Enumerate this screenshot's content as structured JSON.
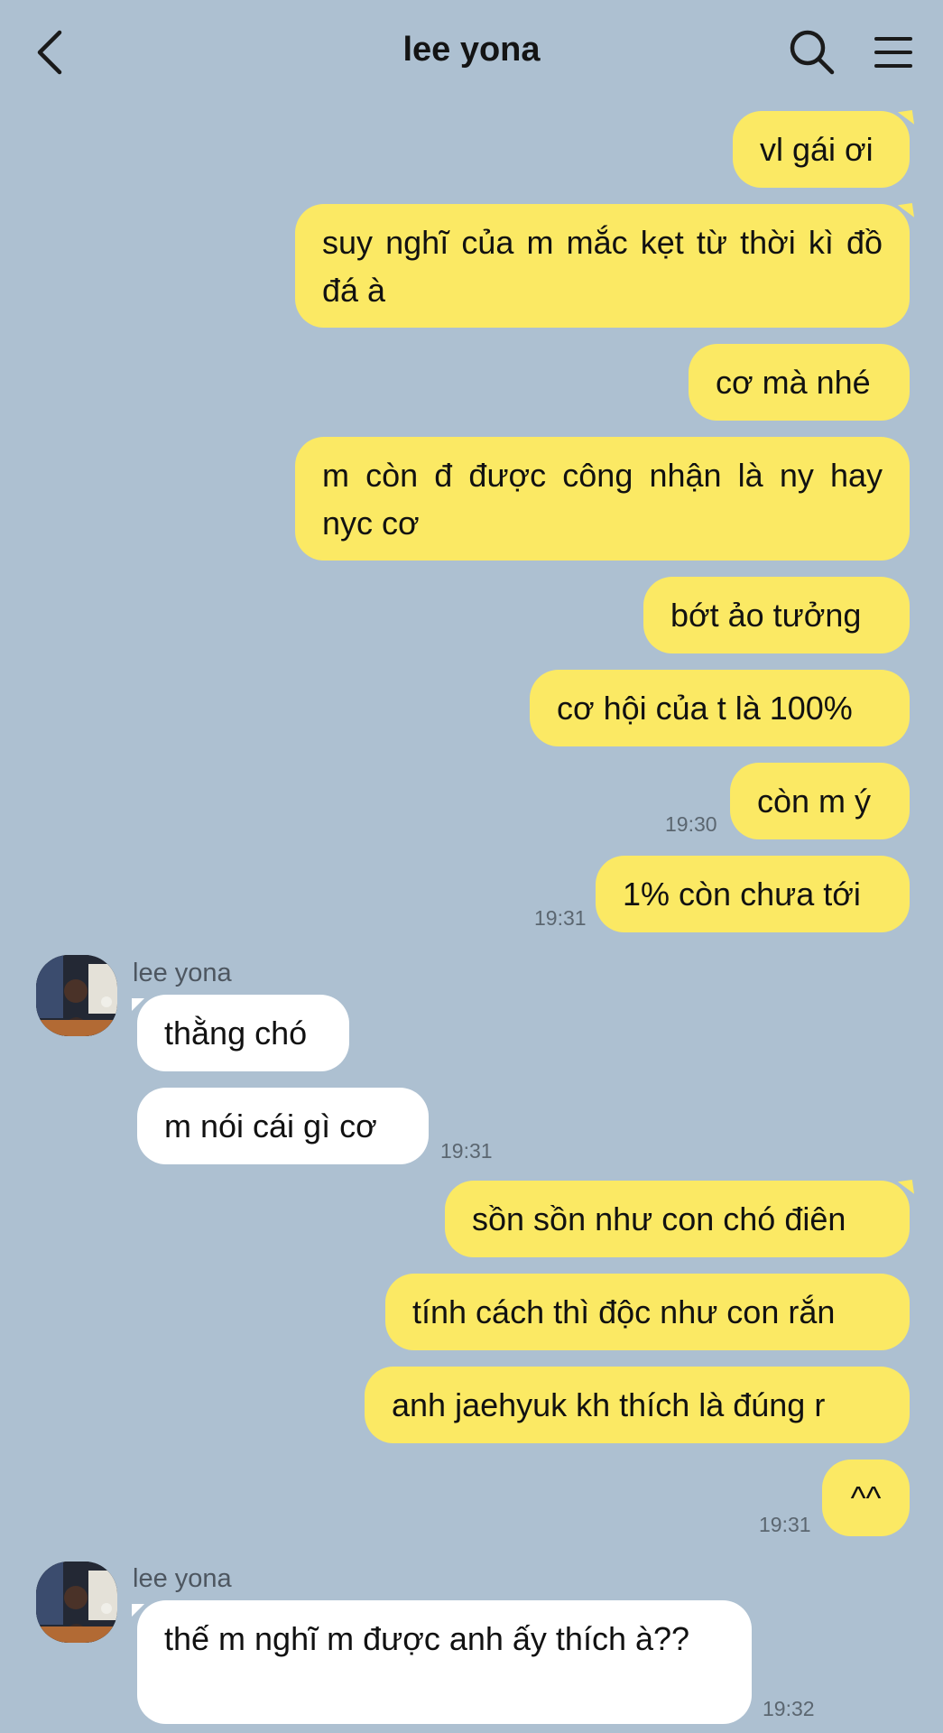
{
  "header": {
    "back_icon": "chevron-left-icon",
    "title": "lee yona",
    "search_icon": "search-icon",
    "menu_icon": "menu-icon"
  },
  "contact_name": "lee yona",
  "messages": [
    {
      "text": "vl gái ơi"
    },
    {
      "text": "suy nghĩ của m mắc kẹt từ thời kì đồ đá à"
    },
    {
      "text": "cơ mà nhé"
    },
    {
      "text": "m còn đ được công nhận là ny hay nyc cơ"
    },
    {
      "text": "bớt ảo tưởng"
    },
    {
      "text": "cơ hội của t là 100%"
    },
    {
      "text": "còn m ý",
      "time": "19:30"
    },
    {
      "text": "1% còn chưa tới",
      "time": "19:31"
    },
    {
      "text": "thằng chó"
    },
    {
      "text": "m nói cái gì cơ",
      "time": "19:31"
    },
    {
      "text": "sồn sồn như con chó điên"
    },
    {
      "text": "tính cách thì độc như con rắn"
    },
    {
      "text": "anh jaehyuk kh thích là đúng r"
    },
    {
      "text": "^^",
      "time": "19:31"
    },
    {
      "text": "thế m nghĩ m được anh ấy thích à??",
      "time": "19:32"
    }
  ],
  "colors": {
    "background": "#adc0d1",
    "my_bubble": "#fbe964",
    "their_bubble": "#ffffff"
  }
}
